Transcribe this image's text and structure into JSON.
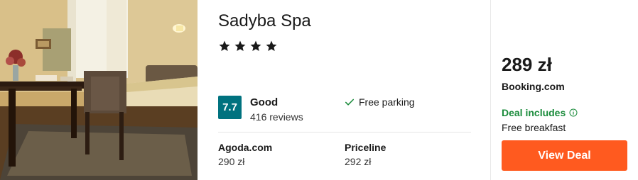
{
  "hotel": {
    "name": "Sadyba Spa",
    "stars": 4
  },
  "rating": {
    "score": "7.7",
    "label": "Good",
    "reviews": "416 reviews",
    "badge_color": "#00727f"
  },
  "amenity": {
    "label": "Free parking",
    "icon": "check-icon"
  },
  "alternatives": [
    {
      "provider": "Agoda.com",
      "price": "290 zł"
    },
    {
      "provider": "Priceline",
      "price": "292 zł"
    }
  ],
  "deal": {
    "price": "289 zł",
    "provider": "Booking.com",
    "includes_label": "Deal includes",
    "includes_item": "Free breakfast",
    "button_label": "View Deal",
    "accent_color": "#ff5a1f",
    "includes_color": "#1a8b3b"
  }
}
